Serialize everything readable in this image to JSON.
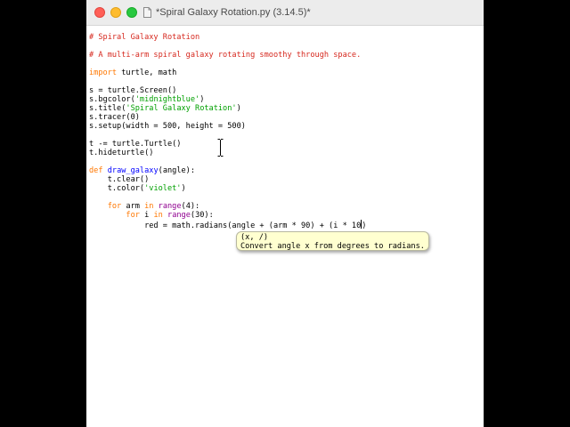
{
  "window": {
    "title": "*Spiral Galaxy Rotation.py (3.14.5)*"
  },
  "code": {
    "l1": "# Spiral Galaxy Rotation",
    "l3": "# A multi-arm spiral galaxy rotating smoothy through space.",
    "l5_kw": "import",
    "l5_rest": " turtle, math",
    "l7": "s = turtle.Screen()",
    "l8_a": "s.bgcolor(",
    "l8_str": "'midnightblue'",
    "l8_b": ")",
    "l9_a": "s.title(",
    "l9_str": "'Spiral Galaxy Rotation'",
    "l9_b": ")",
    "l10": "s.tracer(0)",
    "l11": "s.setup(width = 500, height = 500)",
    "l13": "t -= turtle.Turtle()",
    "l14": "t.hideturtle()",
    "l16_kw": "def",
    "l16_sp": " ",
    "l16_name": "draw_galaxy",
    "l16_rest": "(angle):",
    "l17": "    t.clear()",
    "l18_a": "    t.color(",
    "l18_str": "'violet'",
    "l18_b": ")",
    "l20_ind": "    ",
    "l20_kw1": "for",
    "l20_a": " arm ",
    "l20_kw2": "in",
    "l20_sp": " ",
    "l20_bi": "range",
    "l20_b": "(4):",
    "l21_ind": "        ",
    "l21_kw1": "for",
    "l21_a": " i ",
    "l21_kw2": "in",
    "l21_sp": " ",
    "l21_bi": "range",
    "l21_b": "(30):",
    "l22_a": "            red = math.radians(angle + (arm * 90) + (i * 10",
    "l22_b": ")"
  },
  "calltip": {
    "signature": "(x, /)",
    "description": "Convert angle x from degrees to radians."
  },
  "colors": {
    "comment": "#d6281e",
    "keyword": "#ff7700",
    "string": "#00a000",
    "definition": "#0000ff",
    "builtin": "#900090",
    "calltip_bg": "#ffffd0"
  },
  "icons": [
    "close-button",
    "minimize-button",
    "zoom-button",
    "document-icon",
    "ibeam-cursor-icon"
  ]
}
